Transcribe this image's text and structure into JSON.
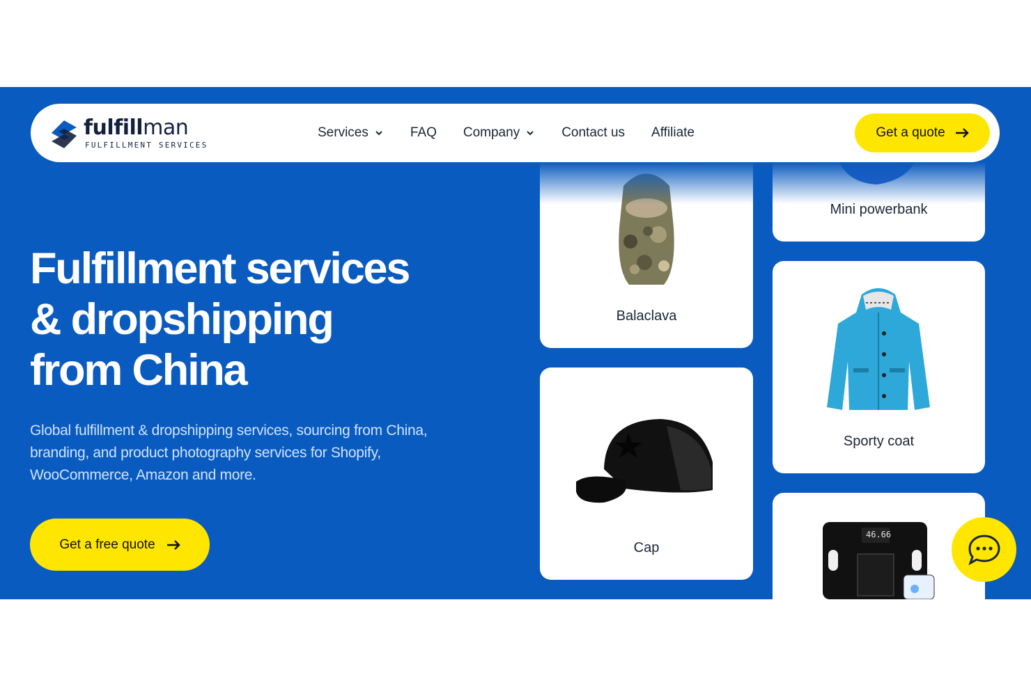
{
  "nav": {
    "logo": {
      "word_bold": "fulfill",
      "word_light": "man",
      "tagline": "FULFILLMENT SERVICES"
    },
    "links": [
      {
        "label": "Services",
        "dropdown": true
      },
      {
        "label": "FAQ",
        "dropdown": false
      },
      {
        "label": "Company",
        "dropdown": true
      },
      {
        "label": "Contact us",
        "dropdown": false
      },
      {
        "label": "Affiliate",
        "dropdown": false
      }
    ],
    "cta_label": "Get a quote"
  },
  "hero": {
    "title_line1": "Fulfillment services",
    "title_line2": "& dropshipping",
    "title_line3": "from China",
    "description": "Global fulfillment & dropshipping services, sourcing from China, branding, and product photography services for Shopify, WooCommerce, Amazon and more.",
    "cta_label": "Get a free quote"
  },
  "products": [
    {
      "label": "Balaclava",
      "icon": "balaclava-image"
    },
    {
      "label": "Cap",
      "icon": "cap-image"
    },
    {
      "label": "Mini powerbank",
      "icon": "powerbank-image"
    },
    {
      "label": "Sporty coat",
      "icon": "coat-image"
    },
    {
      "label": "",
      "icon": "scale-image"
    }
  ],
  "scale_display": "46.66",
  "colors": {
    "brand_blue": "#0a5bbf",
    "accent_yellow": "#ffe600",
    "text_dark": "#1b2536"
  }
}
